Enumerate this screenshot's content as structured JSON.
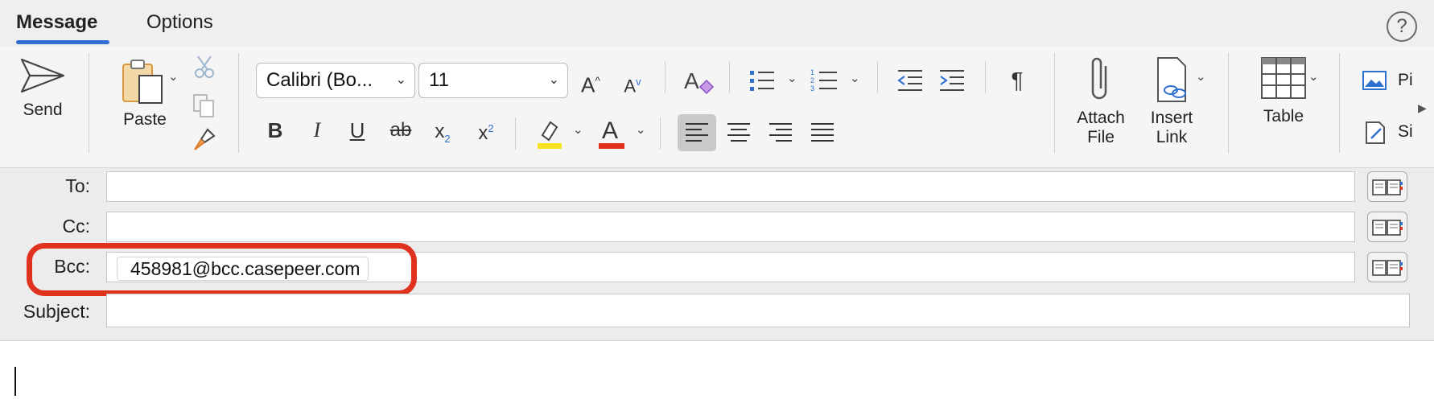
{
  "tabs": [
    {
      "label": "Message",
      "active": true
    },
    {
      "label": "Options",
      "active": false
    }
  ],
  "help_icon": "?",
  "ribbon": {
    "send_label": "Send",
    "paste_label": "Paste",
    "font_name": "Calibri (Bo...",
    "font_size": "11",
    "attach_label_1": "Attach",
    "attach_label_2": "File",
    "insert_label_1": "Insert",
    "insert_label_2": "Link",
    "table_label": "Table",
    "pictures_label": "Pi",
    "signature_label": "Si"
  },
  "fields": {
    "to_label": "To:",
    "cc_label": "Cc:",
    "bcc_label": "Bcc:",
    "subject_label": "Subject:",
    "bcc_recipient": "458981@bcc.casepeer.com",
    "to_value": "",
    "cc_value": "",
    "subject_value": ""
  },
  "colors": {
    "accent": "#2f6fcf",
    "highlight_ring": "#e0321f",
    "highlight_color_bar": "#f5e321",
    "font_color_bar": "#e0321f"
  }
}
